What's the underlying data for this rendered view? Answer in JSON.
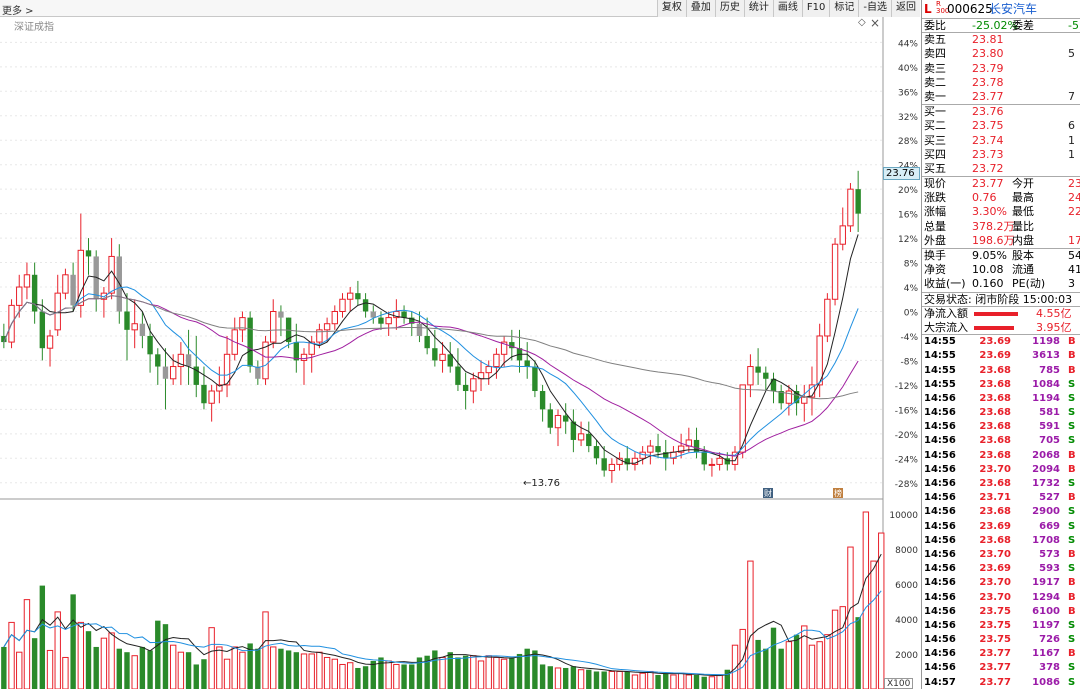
{
  "app": {
    "more": "更多 >",
    "index_name": "深证成指",
    "diamond": "◇",
    "close": "×",
    "toolbar": [
      "复权",
      "叠加",
      "历史",
      "统计",
      "画线",
      "F10",
      "标记",
      "-自选",
      "返回"
    ],
    "price_tag": "23.76",
    "low_label": "←13.76",
    "scale_label": "X100"
  },
  "chart_data": [
    {
      "type": "candlestick",
      "title": "",
      "ylabel": "",
      "y_axis_labels": [
        "44%",
        "40%",
        "36%",
        "32%",
        "28%",
        "24%",
        "20%",
        "16%",
        "12%",
        "8%",
        "4%",
        "0%",
        "-4%",
        "-8%",
        "-12%",
        "-16%",
        "-20%",
        "-24%",
        "-28%"
      ],
      "ylim_pct": [
        -30,
        47
      ],
      "prev_close": 23.01,
      "candles_pct": [
        [
          -4,
          -2,
          -6,
          -5
        ],
        [
          -5,
          2,
          -6,
          1
        ],
        [
          1,
          6,
          -1,
          4
        ],
        [
          4,
          8,
          2,
          6
        ],
        [
          6,
          8,
          -2,
          0
        ],
        [
          0,
          2,
          -8,
          -6
        ],
        [
          -6,
          -3,
          -9,
          -4
        ],
        [
          -3,
          6,
          -4,
          3
        ],
        [
          3,
          7,
          2,
          6
        ],
        [
          6,
          8,
          0,
          1
        ],
        [
          1,
          16,
          -1,
          10
        ],
        [
          10,
          12,
          6,
          9
        ],
        [
          9,
          10,
          0,
          2
        ],
        [
          2,
          4,
          -1,
          3
        ],
        [
          3,
          12,
          2,
          9
        ],
        [
          9,
          11,
          -2,
          0
        ],
        [
          0,
          3,
          -8,
          -3
        ],
        [
          -3,
          2,
          -6,
          -2
        ],
        [
          -2,
          0,
          -6,
          -4
        ],
        [
          -4,
          -2,
          -10,
          -7
        ],
        [
          -7,
          -6,
          -12,
          -9
        ],
        [
          -9,
          -6,
          -16,
          -11
        ],
        [
          -11,
          -7,
          -12,
          -9
        ],
        [
          -9,
          -5,
          -12,
          -7
        ],
        [
          -7,
          -3,
          -12,
          -9
        ],
        [
          -9,
          -4,
          -14,
          -12
        ],
        [
          -12,
          -9,
          -16,
          -15
        ],
        [
          -15,
          -12,
          -18,
          -13
        ],
        [
          -13,
          -9,
          -15,
          -12
        ],
        [
          -12,
          -4,
          -14,
          -7
        ],
        [
          -7,
          -1,
          -8,
          -3
        ],
        [
          -3,
          0,
          -5,
          -1
        ],
        [
          -1,
          0,
          -10,
          -9
        ],
        [
          -9,
          -8,
          -12,
          -11
        ],
        [
          -11,
          -4,
          -12,
          -5
        ],
        [
          -5,
          2,
          -6,
          0
        ],
        [
          0,
          1,
          -4,
          -1
        ],
        [
          -1,
          -1,
          -6,
          -5
        ],
        [
          -5,
          -2,
          -10,
          -8
        ],
        [
          -8,
          -6,
          -12,
          -7
        ],
        [
          -7,
          -4,
          -10,
          -5
        ],
        [
          -5,
          -2,
          -6,
          -3
        ],
        [
          -3,
          -1,
          -5,
          -2
        ],
        [
          -2,
          1,
          -3,
          0
        ],
        [
          0,
          3,
          -1,
          2
        ],
        [
          2,
          4,
          0,
          3
        ],
        [
          3,
          5,
          1,
          2
        ],
        [
          2,
          3,
          -1,
          0
        ],
        [
          0,
          1,
          -2,
          -1
        ],
        [
          -1,
          0,
          -3,
          -2
        ],
        [
          -2,
          0,
          -4,
          -1
        ],
        [
          -1,
          2,
          -3,
          0
        ],
        [
          0,
          1,
          -2,
          -1
        ],
        [
          -1,
          0,
          -4,
          -2
        ],
        [
          -2,
          0,
          -5,
          -4
        ],
        [
          -4,
          -1,
          -7,
          -6
        ],
        [
          -6,
          -3,
          -9,
          -8
        ],
        [
          -8,
          -5,
          -10,
          -7
        ],
        [
          -7,
          -5,
          -10,
          -9
        ],
        [
          -9,
          -6,
          -13,
          -12
        ],
        [
          -12,
          -10,
          -16,
          -13
        ],
        [
          -13,
          -10,
          -15,
          -11
        ],
        [
          -11,
          -8,
          -13,
          -10
        ],
        [
          -10,
          -8,
          -12,
          -9
        ],
        [
          -9,
          -6,
          -11,
          -7
        ],
        [
          -7,
          -4,
          -9,
          -5
        ],
        [
          -5,
          -3,
          -8,
          -6
        ],
        [
          -6,
          -3,
          -10,
          -8
        ],
        [
          -8,
          -5,
          -11,
          -9
        ],
        [
          -9,
          -8,
          -14,
          -13
        ],
        [
          -13,
          -12,
          -18,
          -16
        ],
        [
          -16,
          -15,
          -20,
          -19
        ],
        [
          -19,
          -16,
          -22,
          -17
        ],
        [
          -17,
          -15,
          -20,
          -18
        ],
        [
          -18,
          -16,
          -23,
          -21
        ],
        [
          -21,
          -18,
          -22,
          -20
        ],
        [
          -20,
          -18,
          -23,
          -22
        ],
        [
          -22,
          -21,
          -25,
          -24
        ],
        [
          -24,
          -22,
          -27,
          -26
        ],
        [
          -26,
          -24,
          -28,
          -25
        ],
        [
          -25,
          -23,
          -26,
          -24
        ],
        [
          -24,
          -22,
          -26,
          -25
        ],
        [
          -25,
          -23,
          -26,
          -24
        ],
        [
          -24,
          -22,
          -25,
          -23
        ],
        [
          -23,
          -21,
          -25,
          -22
        ],
        [
          -22,
          -20,
          -24,
          -23
        ],
        [
          -23,
          -21,
          -26,
          -24
        ],
        [
          -24,
          -22,
          -25,
          -23
        ],
        [
          -23,
          -20,
          -24,
          -22
        ],
        [
          -22,
          -19,
          -23,
          -21
        ],
        [
          -21,
          -19,
          -24,
          -23
        ],
        [
          -23,
          -22,
          -26,
          -25
        ],
        [
          -25,
          -24,
          -27,
          -25
        ],
        [
          -25,
          -23,
          -26,
          -24
        ],
        [
          -24,
          -23,
          -26,
          -25
        ],
        [
          -25,
          -22,
          -26,
          -23
        ],
        [
          -23,
          -15,
          -24,
          -12
        ],
        [
          -12,
          -7,
          -14,
          -9
        ],
        [
          -9,
          -6,
          -12,
          -10
        ],
        [
          -10,
          -9,
          -13,
          -11
        ],
        [
          -11,
          -10,
          -15,
          -13
        ],
        [
          -13,
          -12,
          -16,
          -15
        ],
        [
          -15,
          -12,
          -17,
          -13
        ],
        [
          -13,
          -12,
          -17,
          -15
        ],
        [
          -15,
          -12,
          -18,
          -14
        ],
        [
          -14,
          -9,
          -17,
          -12
        ],
        [
          -12,
          -2,
          -14,
          -4
        ],
        [
          -4,
          3,
          -5,
          2
        ],
        [
          2,
          12,
          1,
          11
        ],
        [
          11,
          17,
          10,
          14
        ],
        [
          14,
          21,
          13,
          20
        ],
        [
          20,
          23,
          13,
          16
        ]
      ],
      "series": [
        {
          "name": "MA5",
          "color": "#222222"
        },
        {
          "name": "MA10",
          "color": "#2090e0"
        },
        {
          "name": "MA20",
          "color": "#a020a0"
        },
        {
          "name": "MA60",
          "color": "#808080"
        }
      ],
      "annotations": [
        "财",
        "榜"
      ]
    },
    {
      "type": "bar",
      "title": "",
      "ylabel": "",
      "y_axis_labels": [
        "10000",
        "8000",
        "6000",
        "4000",
        "2000"
      ],
      "ylim": [
        0,
        10500
      ],
      "values": [
        2400,
        3800,
        2100,
        5100,
        2900,
        5900,
        2200,
        4400,
        1800,
        5400,
        3800,
        3300,
        2400,
        2900,
        3200,
        2300,
        2100,
        1900,
        2400,
        2200,
        3900,
        3700,
        2500,
        2100,
        2100,
        1400,
        1700,
        3500,
        2400,
        1700,
        2400,
        2100,
        2600,
        2300,
        4400,
        2400,
        2300,
        2200,
        2100,
        2000,
        2000,
        2100,
        1800,
        1700,
        1400,
        1500,
        1200,
        1300,
        1600,
        1800,
        1600,
        1400,
        1400,
        1400,
        1800,
        1900,
        2200,
        1800,
        2100,
        1800,
        1900,
        1900,
        1600,
        1900,
        1800,
        1700,
        1800,
        2000,
        2300,
        2200,
        1400,
        1300,
        1200,
        1200,
        1300,
        1100,
        1100,
        1000,
        1000,
        1000,
        1000,
        1000,
        800,
        900,
        1000,
        800,
        900,
        800,
        900,
        800,
        800,
        700,
        700,
        800,
        1100,
        2500,
        3400,
        7300,
        2800,
        2300,
        3500,
        2300,
        2700,
        3100,
        3600,
        2500,
        2700,
        3100,
        4500,
        4700,
        8100,
        4100,
        10100,
        7300,
        8900
      ]
    }
  ],
  "quote": {
    "badge_l": "L",
    "badge_r": "R\n300",
    "code": "000625",
    "name": "长安汽车",
    "wei_bi_label": "委比",
    "wei_bi": "-25.02%",
    "wei_cha_label": "委差",
    "wei_cha": "-5",
    "asks": [
      {
        "label": "卖五",
        "price": "23.81",
        "vol": ""
      },
      {
        "label": "卖四",
        "price": "23.80",
        "vol": "5"
      },
      {
        "label": "卖三",
        "price": "23.79",
        "vol": ""
      },
      {
        "label": "卖二",
        "price": "23.78",
        "vol": ""
      },
      {
        "label": "卖一",
        "price": "23.77",
        "vol": "7"
      }
    ],
    "bids": [
      {
        "label": "买一",
        "price": "23.76",
        "vol": ""
      },
      {
        "label": "买二",
        "price": "23.75",
        "vol": "6"
      },
      {
        "label": "买三",
        "price": "23.74",
        "vol": "1"
      },
      {
        "label": "买四",
        "price": "23.73",
        "vol": "1"
      },
      {
        "label": "买五",
        "price": "23.72",
        "vol": ""
      }
    ],
    "stats": [
      {
        "l1": "现价",
        "v1": "23.77",
        "l2": "今开",
        "v2": "23"
      },
      {
        "l1": "涨跌",
        "v1": "0.76",
        "l2": "最高",
        "v2": "24"
      },
      {
        "l1": "涨幅",
        "v1": "3.30%",
        "l2": "最低",
        "v2": "22"
      },
      {
        "l1": "总量",
        "v1": "378.2万",
        "l2": "量比",
        "v2": ""
      },
      {
        "l1": "外盘",
        "v1": "198.6万",
        "l2": "内盘",
        "v2": "179."
      }
    ],
    "stats2": [
      {
        "l1": "换手",
        "v1": "9.05%",
        "l2": "股本",
        "v2": "54."
      },
      {
        "l1": "净资",
        "v1": "10.08",
        "l2": "流通",
        "v2": "41."
      },
      {
        "l1": "收益(一)",
        "v1": "0.160",
        "l2": "PE(动)",
        "v2": "3"
      }
    ],
    "trade_status": "交易状态: 闭市阶段 15:00:03",
    "net_inflow_label": "净流入额",
    "net_inflow": "4.55亿",
    "block_inflow_label": "大宗流入",
    "block_inflow": "3.95亿",
    "ticks": [
      [
        "14:55",
        "23.69",
        "1198",
        "B"
      ],
      [
        "14:55",
        "23.69",
        "3613",
        "B"
      ],
      [
        "14:55",
        "23.68",
        "785",
        "B"
      ],
      [
        "14:55",
        "23.68",
        "1084",
        "S"
      ],
      [
        "14:56",
        "23.68",
        "1194",
        "S"
      ],
      [
        "14:56",
        "23.68",
        "581",
        "S"
      ],
      [
        "14:56",
        "23.68",
        "591",
        "S"
      ],
      [
        "14:56",
        "23.68",
        "705",
        "S"
      ],
      [
        "14:56",
        "23.68",
        "2068",
        "B"
      ],
      [
        "14:56",
        "23.70",
        "2094",
        "B"
      ],
      [
        "14:56",
        "23.68",
        "1732",
        "S"
      ],
      [
        "14:56",
        "23.71",
        "527",
        "B"
      ],
      [
        "14:56",
        "23.68",
        "2900",
        "S"
      ],
      [
        "14:56",
        "23.69",
        "669",
        "S"
      ],
      [
        "14:56",
        "23.68",
        "1708",
        "S"
      ],
      [
        "14:56",
        "23.70",
        "573",
        "B"
      ],
      [
        "14:56",
        "23.69",
        "593",
        "S"
      ],
      [
        "14:56",
        "23.70",
        "1917",
        "B"
      ],
      [
        "14:56",
        "23.70",
        "1294",
        "B"
      ],
      [
        "14:56",
        "23.75",
        "6100",
        "B"
      ],
      [
        "14:56",
        "23.75",
        "1197",
        "S"
      ],
      [
        "14:56",
        "23.75",
        "726",
        "S"
      ],
      [
        "14:56",
        "23.77",
        "1167",
        "B"
      ],
      [
        "14:56",
        "23.77",
        "378",
        "S"
      ],
      [
        "14:57",
        "23.77",
        "1086",
        "S"
      ]
    ]
  }
}
